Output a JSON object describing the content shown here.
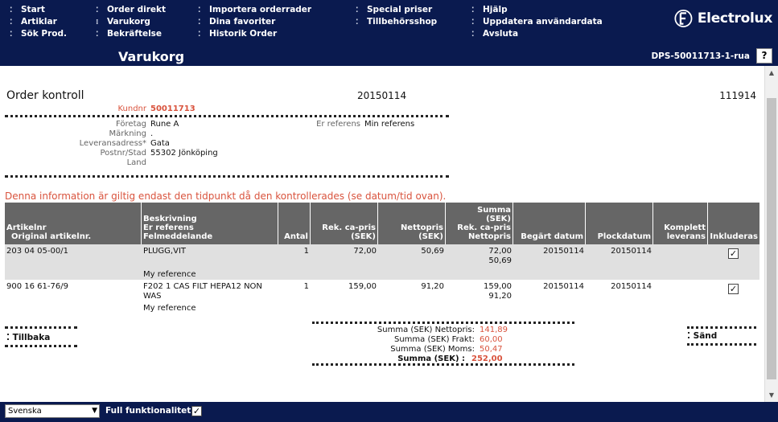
{
  "nav": {
    "col1": [
      {
        "label": "Start"
      },
      {
        "label": "Artiklar"
      },
      {
        "label": "Sök Prod."
      }
    ],
    "col2": [
      {
        "label": "Order direkt"
      },
      {
        "label": "Varukorg"
      },
      {
        "label": "Bekräftelse"
      }
    ],
    "col3": [
      {
        "label": "Importera orderrader"
      },
      {
        "label": "Dina favoriter"
      },
      {
        "label": "Historik Order"
      }
    ],
    "col4": [
      {
        "label": "Special priser"
      },
      {
        "label": "Tillbehörsshop"
      }
    ],
    "col5": [
      {
        "label": "Hjälp"
      },
      {
        "label": "Uppdatera användardata"
      },
      {
        "label": "Avsluta"
      }
    ]
  },
  "brand": {
    "name": "Electrolux",
    "logo_icon": "electrolux-logo-icon"
  },
  "header": {
    "title": "Varukorg",
    "doc_id": "DPS-50011713-1-rua",
    "help_label": "?"
  },
  "order": {
    "title": "Order kontroll",
    "date": "20150114",
    "number": "111914",
    "kundnr_label": "Kundnr",
    "kundnr": "50011713",
    "fields": {
      "foretag_label": "Företag",
      "foretag": "Rune A",
      "markning_label": "Märkning",
      "markning": ".",
      "leveransadress_label": "Leveransadress*",
      "leveransadress": "Gata",
      "postnr_label": "Postnr/Stad",
      "postnr": "55302 Jönköping",
      "land_label": "Land",
      "land": "",
      "erref_label": "Er referens",
      "erref": "Min referens"
    },
    "warning": "Denna information är giltig endast den tidpunkt då den kontrollerades (se datum/tid ovan)."
  },
  "table": {
    "headers": {
      "artikelnr": [
        "Artikelnr",
        "Original artikelnr."
      ],
      "beskrivning": [
        "Beskrivning",
        "Er referens",
        "Felmeddelande"
      ],
      "antal": [
        "Antal"
      ],
      "rek": [
        "Rek. ca-pris",
        "(SEK)"
      ],
      "netto": [
        "Nettopris",
        "(SEK)"
      ],
      "summa": [
        "Summa",
        "(SEK)",
        "Rek. ca-pris",
        "Nettopris"
      ],
      "begart": [
        "Begärt datum"
      ],
      "plock": [
        "Plockdatum"
      ],
      "komplett": [
        "Komplett",
        "leverans"
      ],
      "inkl": [
        "Inkluderas"
      ]
    },
    "rows": [
      {
        "artikelnr": "203 04 05-00/1",
        "beskrivning": "PLUGG,VIT",
        "referens": "My reference",
        "antal": "1",
        "rek": "72,00",
        "netto": "50,69",
        "summa_rek": "72,00",
        "summa_netto": "50,69",
        "begart": "20150114",
        "plock": "20150114",
        "inkl": true
      },
      {
        "artikelnr": "900 16 61-76/9",
        "beskrivning": "F202 1 CAS FILT HEPA12 NON WAS",
        "referens": "My reference",
        "antal": "1",
        "rek": "159,00",
        "netto": "91,20",
        "summa_rek": "159,00",
        "summa_netto": "91,20",
        "begart": "20150114",
        "plock": "20150114",
        "inkl": true
      }
    ]
  },
  "summary": {
    "netto_label": "Summa  (SEK) Nettopris:",
    "netto": "141,89",
    "frakt_label": "Summa  (SEK) Frakt:",
    "frakt": "60,00",
    "moms_label": "Summa  (SEK) Moms:",
    "moms": "50,47",
    "total_label": "Summa  (SEK) :",
    "total": "252,00"
  },
  "actions": {
    "back": "Tillbaka",
    "send": "Sänd"
  },
  "footer": {
    "language": "Svenska",
    "full_label": "Full funktionalitet:",
    "full_checked": true
  }
}
